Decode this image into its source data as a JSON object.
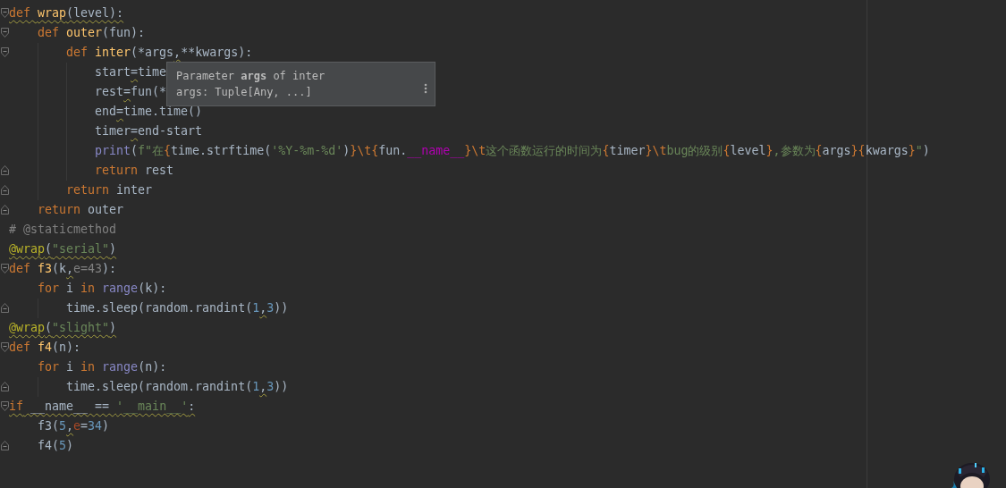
{
  "editor": {
    "lines": [
      {
        "fold_start": true,
        "tokens": [
          {
            "t": "def ",
            "kind": "kw",
            "warning": true
          },
          {
            "t": "wrap",
            "kind": "fn",
            "warning": true
          },
          {
            "t": "(level):",
            "kind": "plain",
            "warning": true
          }
        ],
        "children": [
          {
            "fold_start": true,
            "tokens": [
              {
                "t": "def ",
                "kind": "kw"
              },
              {
                "t": "outer",
                "kind": "fn"
              },
              {
                "t": "(fun):",
                "kind": "plain"
              }
            ],
            "children": [
              {
                "fold_start": true,
                "tokens": [
                  {
                    "t": "def ",
                    "kind": "kw"
                  },
                  {
                    "t": "inter",
                    "kind": "fn"
                  },
                  {
                    "t": "(*args",
                    "kind": "plain"
                  },
                  {
                    "t": ",",
                    "kind": "plain",
                    "warning": true
                  },
                  {
                    "t": "**kwargs):",
                    "kind": "plain"
                  }
                ],
                "children": [
                  {
                    "tokens": [
                      {
                        "t": "start",
                        "kind": "plain"
                      },
                      {
                        "t": "=",
                        "kind": "plain",
                        "warning": true
                      },
                      {
                        "t": "time",
                        "kind": "plain"
                      }
                    ]
                  },
                  {
                    "tokens": [
                      {
                        "t": "rest",
                        "kind": "plain"
                      },
                      {
                        "t": "=",
                        "kind": "plain",
                        "warning": true
                      },
                      {
                        "t": "fun(*",
                        "kind": "plain"
                      }
                    ]
                  },
                  {
                    "tokens": [
                      {
                        "t": "end",
                        "kind": "plain"
                      },
                      {
                        "t": "=",
                        "kind": "plain",
                        "warning": true
                      },
                      {
                        "t": "time.time()",
                        "kind": "plain"
                      }
                    ]
                  },
                  {
                    "tokens": [
                      {
                        "t": "timer",
                        "kind": "plain"
                      },
                      {
                        "t": "=",
                        "kind": "plain",
                        "warning": true
                      },
                      {
                        "t": "end-start",
                        "kind": "plain"
                      }
                    ]
                  },
                  {
                    "tokens": [
                      {
                        "t": "print",
                        "kind": "builtin"
                      },
                      {
                        "t": "(",
                        "kind": "plain"
                      },
                      {
                        "t": "f\"在",
                        "kind": "str"
                      },
                      {
                        "t": "{",
                        "kind": "kw"
                      },
                      {
                        "t": "time.strftime(",
                        "kind": "plain"
                      },
                      {
                        "t": "'%Y-%m-%d'",
                        "kind": "str"
                      },
                      {
                        "t": ")",
                        "kind": "plain"
                      },
                      {
                        "t": "}\\t{",
                        "kind": "kw"
                      },
                      {
                        "t": "fun.",
                        "kind": "plain"
                      },
                      {
                        "t": "__name__",
                        "kind": "magic"
                      },
                      {
                        "t": "}\\t",
                        "kind": "kw"
                      },
                      {
                        "t": "这个函数运行的时间为",
                        "kind": "str"
                      },
                      {
                        "t": "{",
                        "kind": "kw"
                      },
                      {
                        "t": "timer",
                        "kind": "plain"
                      },
                      {
                        "t": "}\\t",
                        "kind": "kw"
                      },
                      {
                        "t": "bug的级别",
                        "kind": "str"
                      },
                      {
                        "t": "{",
                        "kind": "kw"
                      },
                      {
                        "t": "level",
                        "kind": "plain"
                      },
                      {
                        "t": "}",
                        "kind": "kw"
                      },
                      {
                        "t": ",参数为",
                        "kind": "str"
                      },
                      {
                        "t": "{",
                        "kind": "kw"
                      },
                      {
                        "t": "args",
                        "kind": "plain"
                      },
                      {
                        "t": "}{",
                        "kind": "kw"
                      },
                      {
                        "t": "kwargs",
                        "kind": "plain"
                      },
                      {
                        "t": "}",
                        "kind": "kw"
                      },
                      {
                        "t": "\"",
                        "kind": "str"
                      },
                      {
                        "t": ")",
                        "kind": "plain"
                      }
                    ]
                  },
                  {
                    "fold_end": true,
                    "tokens": [
                      {
                        "t": "return",
                        "kind": "kw"
                      },
                      {
                        "t": " rest",
                        "kind": "plain"
                      }
                    ]
                  }
                ]
              },
              {
                "fold_end": true,
                "tokens": [
                  {
                    "t": "return",
                    "kind": "kw"
                  },
                  {
                    "t": " inter",
                    "kind": "plain"
                  }
                ]
              }
            ]
          },
          {
            "fold_end": true,
            "tokens": [
              {
                "t": "return",
                "kind": "kw"
              },
              {
                "t": " outer",
                "kind": "plain"
              }
            ]
          }
        ]
      },
      {
        "tokens": [
          {
            "t": "# @staticmethod",
            "kind": "comment"
          }
        ]
      },
      {
        "tokens": [
          {
            "t": "@wrap",
            "kind": "deco",
            "warning": true
          },
          {
            "t": "(",
            "kind": "plain",
            "warning": true
          },
          {
            "t": "\"serial\"",
            "kind": "str",
            "warning": true
          },
          {
            "t": ")",
            "kind": "plain",
            "warning": true
          }
        ]
      },
      {
        "fold_start": true,
        "tokens": [
          {
            "t": "def ",
            "kind": "kw"
          },
          {
            "t": "f3",
            "kind": "fn"
          },
          {
            "t": "(k",
            "kind": "plain"
          },
          {
            "t": ",",
            "kind": "plain",
            "warning": true
          },
          {
            "t": "e=43",
            "kind": "comment"
          },
          {
            "t": "):",
            "kind": "plain"
          }
        ],
        "children": [
          {
            "tokens": [
              {
                "t": "for",
                "kind": "kw"
              },
              {
                "t": " i ",
                "kind": "plain"
              },
              {
                "t": "in ",
                "kind": "kw"
              },
              {
                "t": "range",
                "kind": "builtin"
              },
              {
                "t": "(k):",
                "kind": "plain"
              }
            ],
            "children": [
              {
                "fold_end": true,
                "tokens": [
                  {
                    "t": "time.sleep(random.randint(",
                    "kind": "plain"
                  },
                  {
                    "t": "1",
                    "kind": "num"
                  },
                  {
                    "t": ",",
                    "kind": "plain",
                    "warning": true
                  },
                  {
                    "t": "3",
                    "kind": "num"
                  },
                  {
                    "t": "))",
                    "kind": "plain"
                  }
                ]
              }
            ]
          }
        ]
      },
      {
        "tokens": [
          {
            "t": "@wrap",
            "kind": "deco",
            "warning": true
          },
          {
            "t": "(",
            "kind": "plain",
            "warning": true
          },
          {
            "t": "\"slight\"",
            "kind": "str",
            "warning": true
          },
          {
            "t": ")",
            "kind": "plain",
            "warning": true
          }
        ]
      },
      {
        "fold_start": true,
        "tokens": [
          {
            "t": "def ",
            "kind": "kw"
          },
          {
            "t": "f4",
            "kind": "fn"
          },
          {
            "t": "(n):",
            "kind": "plain"
          }
        ],
        "children": [
          {
            "tokens": [
              {
                "t": "for",
                "kind": "kw"
              },
              {
                "t": " i ",
                "kind": "plain"
              },
              {
                "t": "in ",
                "kind": "kw"
              },
              {
                "t": "range",
                "kind": "builtin"
              },
              {
                "t": "(n):",
                "kind": "plain"
              }
            ],
            "children": [
              {
                "fold_end": true,
                "tokens": [
                  {
                    "t": "time.sleep(random.randint(",
                    "kind": "plain"
                  },
                  {
                    "t": "1",
                    "kind": "num"
                  },
                  {
                    "t": ",",
                    "kind": "plain",
                    "warning": true
                  },
                  {
                    "t": "3",
                    "kind": "num"
                  },
                  {
                    "t": "))",
                    "kind": "plain"
                  }
                ]
              }
            ]
          }
        ]
      },
      {
        "fold_start": true,
        "tokens": [
          {
            "t": "if",
            "kind": "kw",
            "warning": true
          },
          {
            "t": " __name__ == ",
            "kind": "plain",
            "warning": true
          },
          {
            "t": "'__main__'",
            "kind": "str",
            "warning": true
          },
          {
            "t": ":",
            "kind": "plain",
            "warning": true
          }
        ],
        "children": [
          {
            "tokens": [
              {
                "t": "f3(",
                "kind": "plain"
              },
              {
                "t": "5",
                "kind": "num"
              },
              {
                "t": ",",
                "kind": "plain",
                "warning": true
              },
              {
                "t": "e",
                "kind": "named"
              },
              {
                "t": "=",
                "kind": "plain"
              },
              {
                "t": "34",
                "kind": "num"
              },
              {
                "t": ")",
                "kind": "plain"
              }
            ]
          },
          {
            "fold_end": true,
            "tokens": [
              {
                "t": "f4(",
                "kind": "plain"
              },
              {
                "t": "5",
                "kind": "num"
              },
              {
                "t": ")",
                "kind": "plain"
              }
            ]
          }
        ]
      }
    ]
  },
  "tooltip": {
    "lines": [
      "Parameter **args** of inter",
      "args: Tuple[Any, ...]"
    ]
  }
}
